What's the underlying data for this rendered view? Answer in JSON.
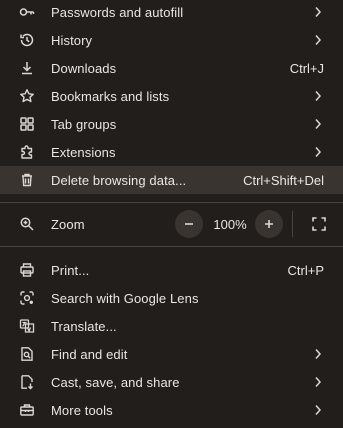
{
  "menu": {
    "items_top": [
      {
        "label": "Passwords and autofill",
        "icon": "key-icon",
        "submenu": true,
        "shortcut": ""
      },
      {
        "label": "History",
        "icon": "history-icon",
        "submenu": true,
        "shortcut": ""
      },
      {
        "label": "Downloads",
        "icon": "download-icon",
        "submenu": false,
        "shortcut": "Ctrl+J"
      },
      {
        "label": "Bookmarks and lists",
        "icon": "star-icon",
        "submenu": true,
        "shortcut": ""
      },
      {
        "label": "Tab groups",
        "icon": "tab-groups-icon",
        "submenu": true,
        "shortcut": ""
      },
      {
        "label": "Extensions",
        "icon": "puzzle-icon",
        "submenu": true,
        "shortcut": ""
      },
      {
        "label": "Delete browsing data...",
        "icon": "trash-icon",
        "submenu": false,
        "shortcut": "Ctrl+Shift+Del",
        "highlighted": true
      }
    ],
    "zoom": {
      "label": "Zoom",
      "value": "100%",
      "minus_icon": "minus-icon",
      "plus_icon": "plus-icon",
      "fullscreen_icon": "fullscreen-icon"
    },
    "items_bottom": [
      {
        "label": "Print...",
        "icon": "printer-icon",
        "submenu": false,
        "shortcut": "Ctrl+P"
      },
      {
        "label": "Search with Google Lens",
        "icon": "lens-icon",
        "submenu": false,
        "shortcut": ""
      },
      {
        "label": "Translate...",
        "icon": "translate-icon",
        "submenu": false,
        "shortcut": ""
      },
      {
        "label": "Find and edit",
        "icon": "find-icon",
        "submenu": true,
        "shortcut": ""
      },
      {
        "label": "Cast, save, and share",
        "icon": "cast-save-icon",
        "submenu": true,
        "shortcut": ""
      },
      {
        "label": "More tools",
        "icon": "toolbox-icon",
        "submenu": true,
        "shortcut": ""
      }
    ]
  },
  "colors": {
    "background": "#221e1b",
    "highlight": "#3a3431",
    "text": "#ebe6e2",
    "divider": "#4a4440"
  }
}
